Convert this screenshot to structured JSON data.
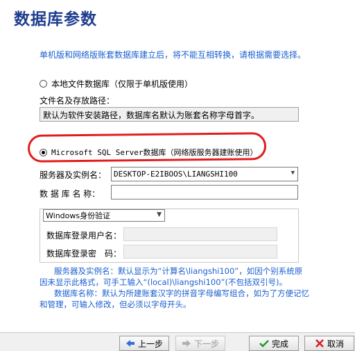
{
  "title": "数据库参数",
  "description": "单机版和网络版账套数据库建立后，将不能互相转换，请根据需要选择。",
  "local_option": {
    "label": "本地文件数据库（仅限于单机版使用）",
    "checked": false,
    "path_label": "文件名及存放路径：",
    "path_value": "默认为软件安装路径，数据库名默认为账套名称字母首字。"
  },
  "sql_option": {
    "label": "Microsoft SQL Server数据库（网络版服务器建账使用）",
    "checked": true
  },
  "server": {
    "label": "服务器及实例名：",
    "value": "DESKTOP-E2IBOOS\\LIANGSHI100"
  },
  "dbname": {
    "label": "数 据 库 名 称：",
    "value": ""
  },
  "auth": {
    "selected": "Windows身份验证",
    "user_label": "数据库登录用户名：",
    "user_value": "",
    "password_label": "数据库登录密　码：",
    "password_value": ""
  },
  "notes": {
    "line1": "服务器及实例名：默认显示为“计算名\\liangshi100”，如因个别系统原",
    "line2": "因未显示此格式，可手工输入“(local)\\liangshi100”(不包括双引号)。",
    "line3": "数据库名称：默认为所建账套汉字的拼音字母编写组合，如为了方便记忆",
    "line4": "和管理，可输入修改，但必须以字母开头。"
  },
  "buttons": {
    "prev": "上一步",
    "next": "下一步",
    "finish": "完成",
    "cancel": "取消"
  },
  "icons": {
    "prev": "arrow-left-icon",
    "next": "arrow-right-icon",
    "finish": "checkmark-icon",
    "cancel": "x-cross-icon"
  },
  "colors": {
    "title": "#1f3d8f",
    "note_text": "#1a5fd0",
    "annotation_oval": "#e21d1d",
    "finish_icon": "#1e9a2c",
    "cancel_icon": "#d21f1f"
  }
}
